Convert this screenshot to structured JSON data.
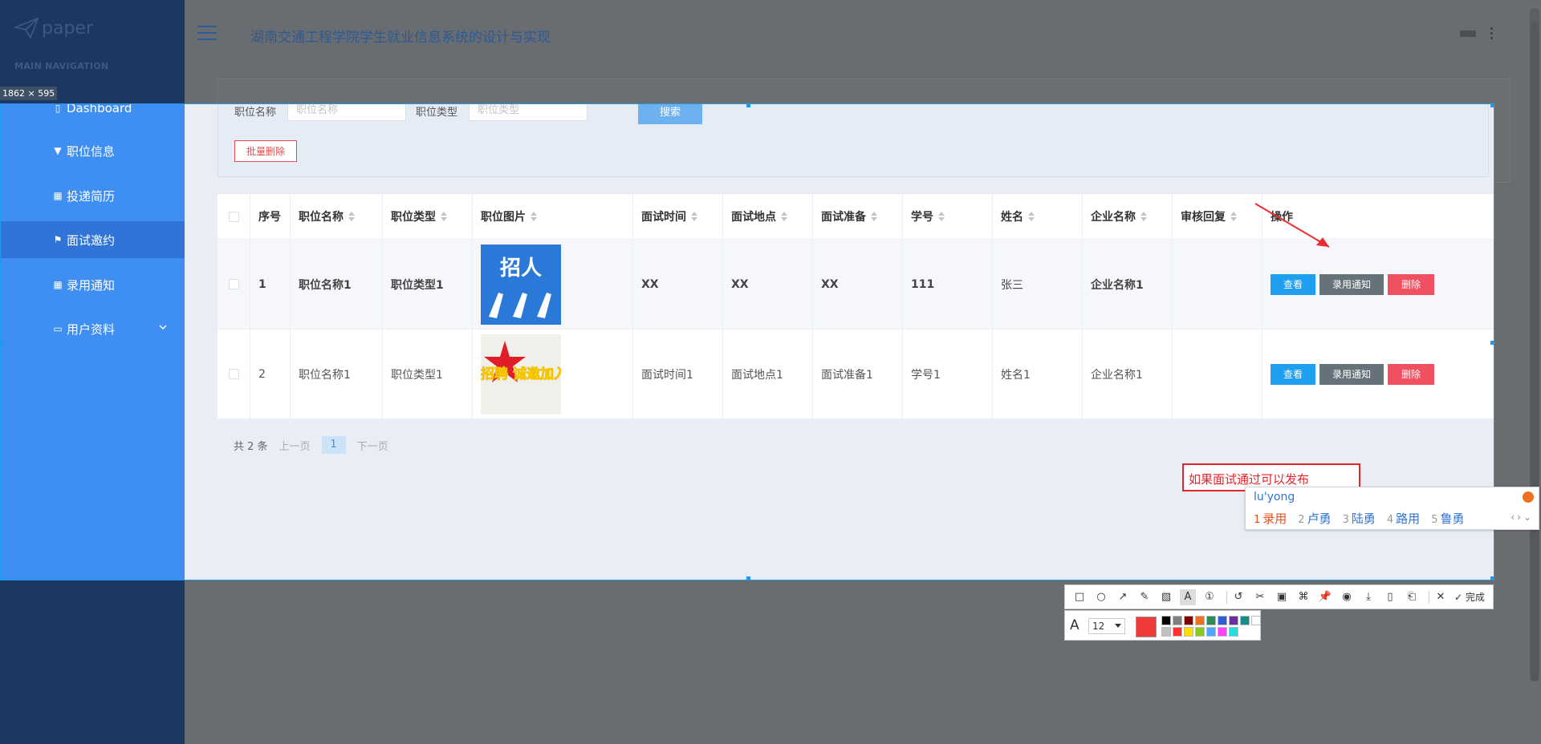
{
  "app": {
    "logo_text": "paper",
    "nav_heading": "MAIN NAVIGATION",
    "title": "湖南交通工程学院学生就业信息系统的设计与实现"
  },
  "sidebar": {
    "items": [
      {
        "label": "Dashboard",
        "icon": "dashboard-icon"
      },
      {
        "label": "职位信息",
        "icon": "pin-icon"
      },
      {
        "label": "投递简历",
        "icon": "grid-icon"
      },
      {
        "label": "面试邀约",
        "icon": "flag-icon",
        "active": true
      },
      {
        "label": "录用通知",
        "icon": "grid-icon"
      },
      {
        "label": "用户资料",
        "icon": "card-icon",
        "has_submenu": true
      }
    ]
  },
  "search": {
    "name_label": "职位名称",
    "name_placeholder": "职位名称",
    "type_label": "职位类型",
    "type_placeholder": "职位类型",
    "search_button": "搜索",
    "batch_delete_button": "批量删除"
  },
  "table": {
    "columns": [
      "序号",
      "职位名称",
      "职位类型",
      "职位图片",
      "面试时间",
      "面试地点",
      "面试准备",
      "学号",
      "姓名",
      "企业名称",
      "审核回复",
      "操作"
    ],
    "rows": [
      {
        "seq": "1",
        "name": "职位名称1",
        "type": "职位类型1",
        "image": "招人",
        "time": "XX",
        "place": "XX",
        "prep": "XX",
        "student_no": "111",
        "student_name": "张三",
        "enterprise": "企业名称1",
        "review": ""
      },
      {
        "seq": "2",
        "name": "职位名称1",
        "type": "职位类型1",
        "image": "招聘 诚邀加入",
        "time": "面试时间1",
        "place": "面试地点1",
        "prep": "面试准备1",
        "student_no": "学号1",
        "student_name": "姓名1",
        "enterprise": "企业名称1",
        "review": ""
      }
    ],
    "actions": {
      "view": "查看",
      "notice": "录用通知",
      "delete": "删除"
    }
  },
  "pager": {
    "total": "共 2 条",
    "prev": "上一页",
    "current": "1",
    "next": "下一页"
  },
  "screenshot_tool": {
    "size_label": "1862 × 595",
    "annotation_text": "如果面试通过可以发布",
    "done_label": "完成",
    "font_size": "12",
    "current_color": "#f03a3a",
    "palette": [
      "#000000",
      "#808080",
      "#800000",
      "#f07020",
      "#2e8b57",
      "#2f5fd6",
      "#6a2f9e",
      "#1a8b8b",
      "#ffffff",
      "#c0c0c0",
      "#ff3030",
      "#ffdd00",
      "#88cc22",
      "#4da6ff",
      "#ff40ff",
      "#22dddd"
    ]
  },
  "ime": {
    "pinyin": "lu'yong",
    "candidates": [
      {
        "n": "1",
        "text": "录用"
      },
      {
        "n": "2",
        "text": "卢勇"
      },
      {
        "n": "3",
        "text": "陆勇"
      },
      {
        "n": "4",
        "text": "路用"
      },
      {
        "n": "5",
        "text": "鲁勇"
      }
    ]
  },
  "colors": {
    "accent": "#3f8ef1",
    "sidebar_dark": "#1c3761",
    "annotation": "#e3242c"
  }
}
